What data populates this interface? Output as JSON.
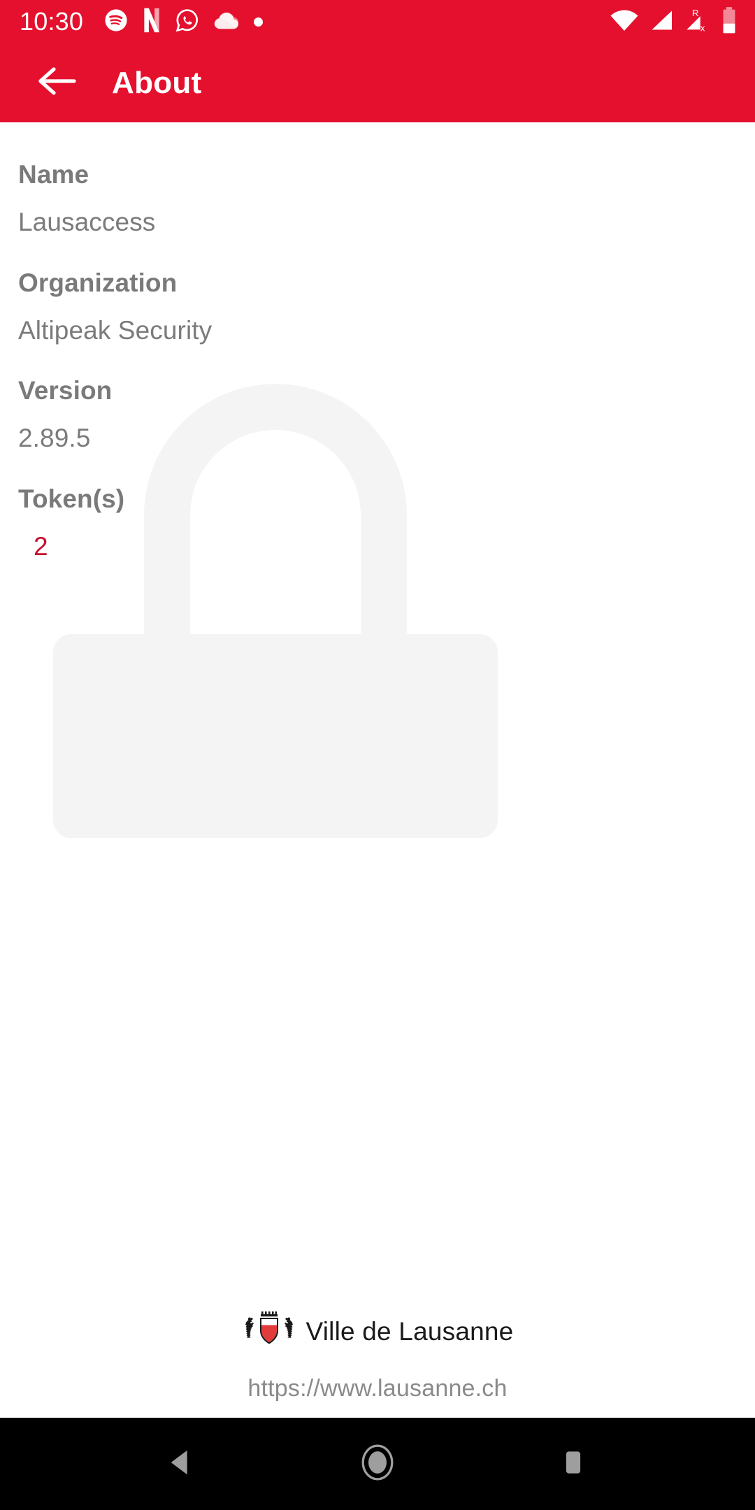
{
  "statusbar": {
    "time": "10:30",
    "left_icons": [
      "spotify-icon",
      "netflix-icon",
      "whatsapp-icon",
      "weather-cloud-icon",
      "dot-indicator-icon"
    ],
    "right_icons": [
      "wifi-icon",
      "signal-icon",
      "roaming-no-service-icon",
      "battery-icon"
    ],
    "background_color": "#E5102E"
  },
  "appbar": {
    "back_icon": "arrow-left-icon",
    "title": "About",
    "background_color": "#E5102E",
    "text_color": "#FFFFFF"
  },
  "watermark": {
    "icon": "padlock-icon",
    "color": "#F5F5F5"
  },
  "info": {
    "items": [
      {
        "label": "Name",
        "value": "Lausaccess"
      },
      {
        "label": "Organization",
        "value": "Altipeak Security"
      },
      {
        "label": "Version",
        "value": "2.89.5"
      },
      {
        "label": "Token(s)",
        "value": "2"
      }
    ],
    "label_color": "#7A7A7A",
    "value_color": "#7B7B7B",
    "token_value_color": "#C8102E"
  },
  "footer": {
    "logo_icon": "lausanne-coat-of-arms-icon",
    "brand": "Ville de Lausanne",
    "url": "https://www.lausanne.ch"
  },
  "navbar": {
    "back_label": "back-triangle-icon",
    "home_label": "home-circle-icon",
    "recents_label": "recents-square-icon",
    "background_color": "#000000"
  }
}
